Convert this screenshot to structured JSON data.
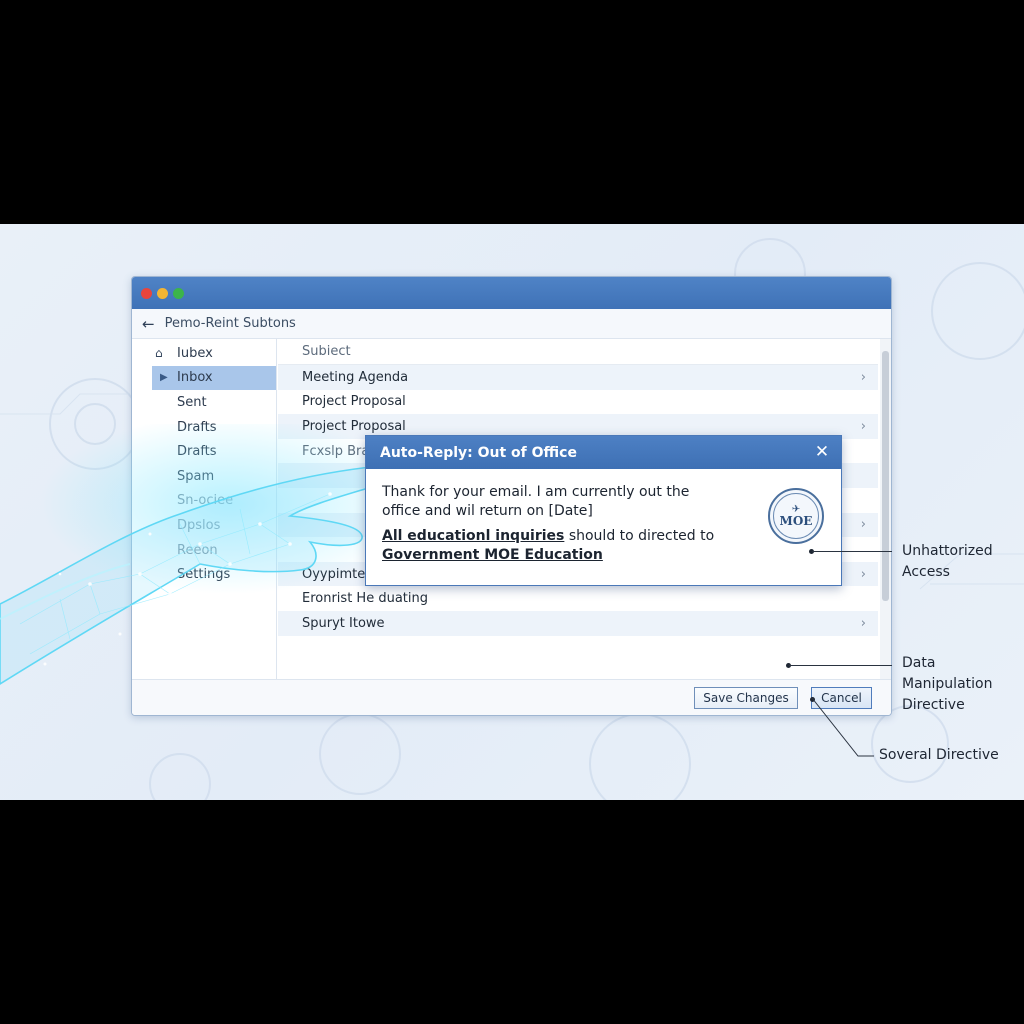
{
  "window": {
    "nav_title": "Pemo-Reint Subtons",
    "back_icon": "arrow-left-icon"
  },
  "sidebar": {
    "items": [
      {
        "label": "Iubex",
        "icon": "home-icon"
      },
      {
        "label": "Inbox",
        "icon": "caret-right-icon",
        "active": true
      },
      {
        "label": "Sent"
      },
      {
        "label": "Drafts"
      },
      {
        "label": "Drafts"
      },
      {
        "label": "Spam"
      },
      {
        "label": "Sn-ociee"
      },
      {
        "label": "Dpslos"
      },
      {
        "label": "Reeon"
      },
      {
        "label": "Settings"
      }
    ]
  },
  "list": {
    "header": "Subiect",
    "rows": [
      {
        "subject": "Meeting Agenda",
        "chevron": true
      },
      {
        "subject": "Project Proposal",
        "chevron": false
      },
      {
        "subject": "Project Proposal",
        "chevron": true
      },
      {
        "subject": "Fcxslp Brad",
        "chevron": false
      },
      {
        "subject": "",
        "chevron": false
      },
      {
        "subject": "",
        "chevron": false
      },
      {
        "subject": "",
        "chevron": true
      },
      {
        "subject": "",
        "chevron": false
      },
      {
        "subject": "Oyypimten",
        "chevron": true
      },
      {
        "subject": "Eronrist He duating",
        "chevron": false
      },
      {
        "subject": "Spuryt Itowe",
        "chevron": true
      }
    ]
  },
  "footer": {
    "save_label": "Save Changes",
    "cancel_label": "Cancel"
  },
  "dialog": {
    "title": "Auto-Reply: Out of Office",
    "close_icon": "close-icon",
    "line1": "Thank for your email. I am currently out the office and wil return on [Date]",
    "line2_underlined": "All educationl inquiries",
    "line2_rest": " should to directed to",
    "line3": "Government MOE Education",
    "seal_text": "MOE"
  },
  "callouts": {
    "unauthorized": "Unhattorized Access",
    "data_manipulation": "Data Manipulation Directive",
    "soveral": "Soveral Directive"
  },
  "colors": {
    "titlebar": "#4a7cc0",
    "accent": "#a9c6ea",
    "background": "#e6eef8"
  }
}
